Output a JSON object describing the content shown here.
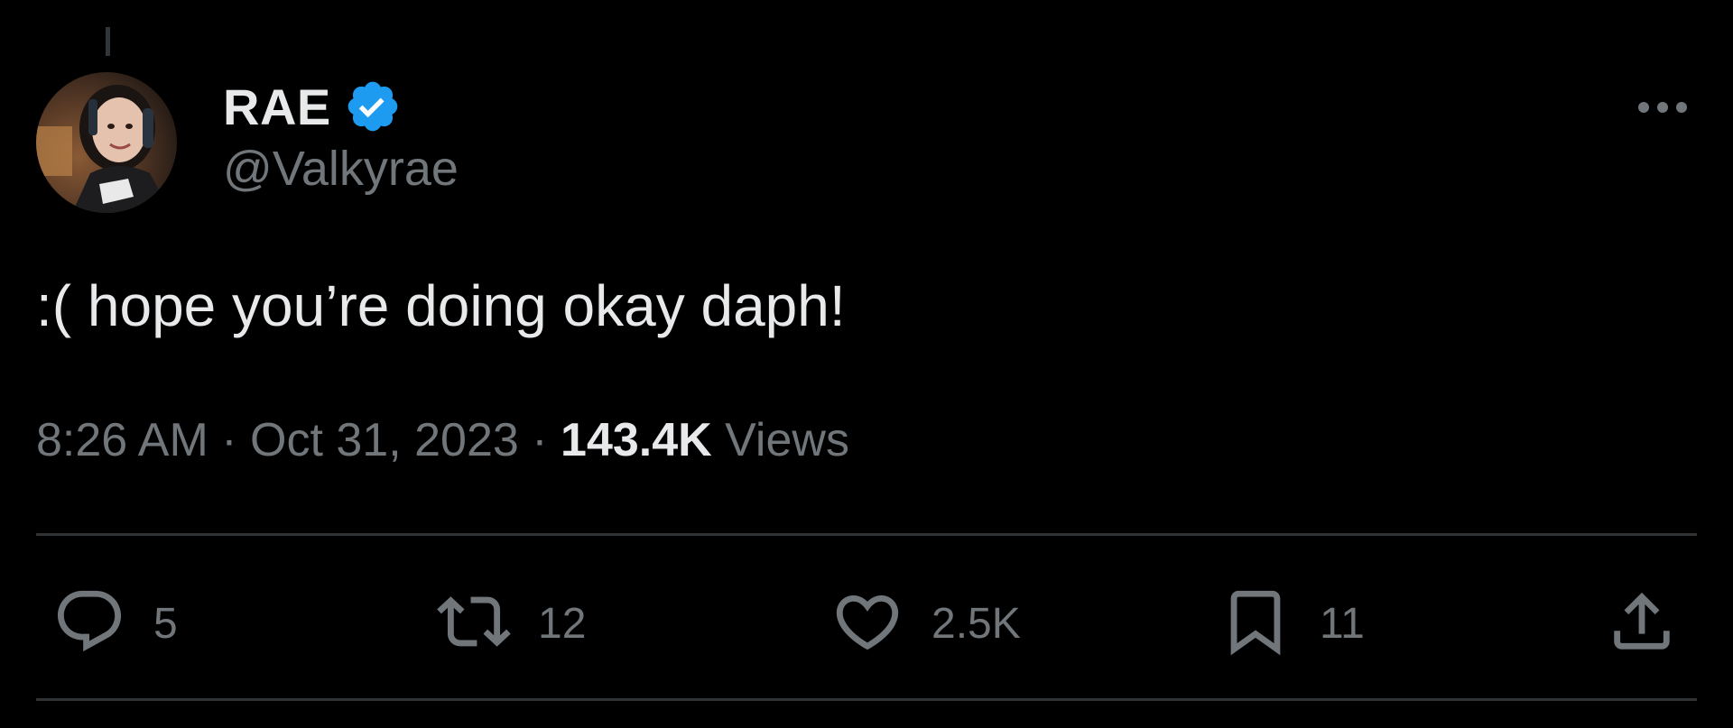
{
  "author": {
    "display_name": "RAE",
    "handle": "@Valkyrae",
    "verified_icon": "verified-badge-icon",
    "avatar": "user-avatar"
  },
  "tweet": {
    "text": ":( hope you’re doing okay daph!",
    "time": "8:26 AM",
    "separator": "·",
    "date": "Oct 31, 2023",
    "views_count": "143.4K",
    "views_label": "Views"
  },
  "actions": {
    "replies": "5",
    "retweets": "12",
    "likes": "2.5K",
    "bookmarks": "11"
  },
  "icons": {
    "more": "more-horizontal-icon",
    "reply": "reply-icon",
    "retweet": "retweet-icon",
    "like": "heart-icon",
    "bookmark": "bookmark-icon",
    "share": "share-icon"
  },
  "colors": {
    "background": "#000000",
    "text_primary": "#e7e9ea",
    "text_secondary": "#71767b",
    "verified_blue": "#1d9bf0",
    "divider": "#2f3336"
  }
}
